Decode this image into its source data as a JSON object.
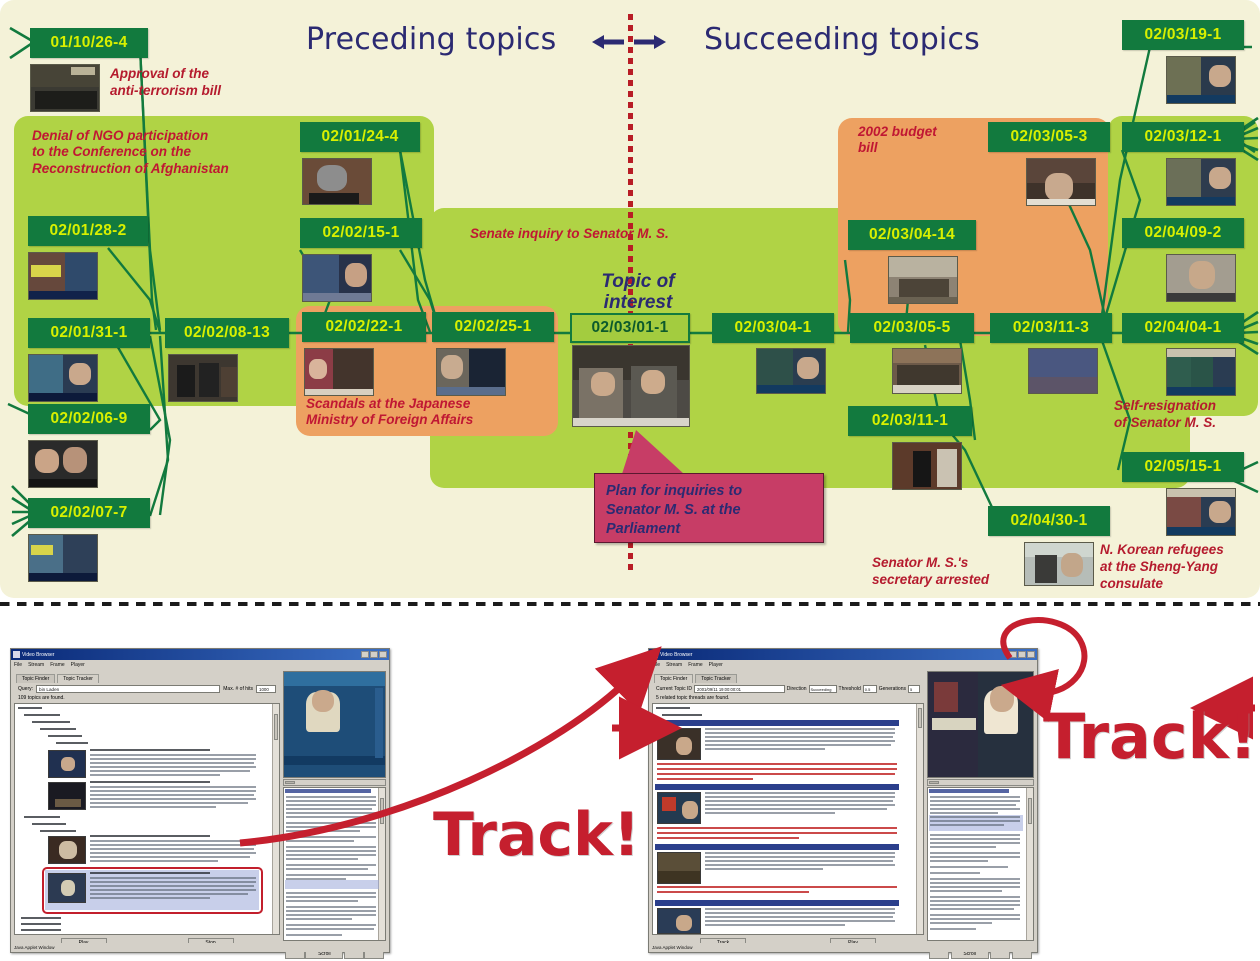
{
  "header": {
    "preceding": "Preceding topics",
    "succeeding": "Succeeding topics",
    "topic_of_interest": "Topic of\ninterest"
  },
  "colors": {
    "background": "#f4f2d8",
    "node_green": "#127a3e",
    "node_text": "#d8f000",
    "group_green": "#b0d345",
    "group_orange": "#eda161",
    "focus_node": "#a3cc3f",
    "caption_red": "#b51b2e",
    "header_blue": "#2b2a72",
    "axis_red": "#b81d25",
    "callout_pink": "#c73d66",
    "track_red": "#c51f2e"
  },
  "nodes": [
    {
      "id": "n01",
      "label": "01/10/26-4"
    },
    {
      "id": "n02",
      "label": "02/01/24-4"
    },
    {
      "id": "n03",
      "label": "02/01/28-2"
    },
    {
      "id": "n04",
      "label": "02/01/31-1"
    },
    {
      "id": "n05",
      "label": "02/02/06-9"
    },
    {
      "id": "n06",
      "label": "02/02/07-7"
    },
    {
      "id": "n07",
      "label": "02/02/08-13"
    },
    {
      "id": "n08",
      "label": "02/02/15-1"
    },
    {
      "id": "n09",
      "label": "02/02/22-1"
    },
    {
      "id": "n10",
      "label": "02/02/25-1"
    },
    {
      "id": "n11",
      "label": "02/03/01-1"
    },
    {
      "id": "n12",
      "label": "02/03/04-1"
    },
    {
      "id": "n13",
      "label": "02/03/04-14"
    },
    {
      "id": "n14",
      "label": "02/03/05-3"
    },
    {
      "id": "n15",
      "label": "02/03/05-5"
    },
    {
      "id": "n16",
      "label": "02/03/11-1"
    },
    {
      "id": "n17",
      "label": "02/03/11-3"
    },
    {
      "id": "n18",
      "label": "02/03/12-1"
    },
    {
      "id": "n19",
      "label": "02/03/19-1"
    },
    {
      "id": "n20",
      "label": "02/04/04-1"
    },
    {
      "id": "n21",
      "label": "02/04/09-2"
    },
    {
      "id": "n22",
      "label": "02/04/30-1"
    },
    {
      "id": "n23",
      "label": "02/05/15-1"
    }
  ],
  "group_labels": {
    "ngo": "Denial of NGO participation\nto the Conference on the\nReconstruction of Afghanistan",
    "senate": "Senate inquiry to Senator M. S.",
    "scandals": "Scandals at the Japanese\nMinistry of Foreign Affairs",
    "budget": "2002 budget\nbill"
  },
  "captions": {
    "approval": "Approval of the\nanti-terrorism bill",
    "self_resignation": "Self-resignation\nof Senator M. S.",
    "secretary": "Senator M. S.'s\nsecretary arrested",
    "refugees": "N. Korean refugees\nat the Sheng-Yang\nconsulate"
  },
  "callout": {
    "text": "Plan for inquiries to\nSenator M. S. at the\nParliament"
  },
  "track": {
    "left_label": "Track!",
    "right_label": "Track!"
  },
  "app_left": {
    "title": "Video Browser",
    "menu": [
      "File",
      "Stream",
      "Frame",
      "Player"
    ],
    "tabs": [
      "Topic Finder",
      "Topic Tracker"
    ],
    "active_tab": "Topic Finder",
    "query_label": "Query:",
    "query_value": "bin Laden",
    "max_label": "Max. # of hits",
    "max_value": "1000",
    "status": "109 topics are found.",
    "tree_root": "Tex Inc",
    "buttons": {
      "play": "Play",
      "stop": "Stop"
    },
    "text_buttons": {
      "prev": "Prev",
      "auto": "Automatic Scroll",
      "play": "Play",
      "next": "Next"
    },
    "statusbar": "Java Applet Window"
  },
  "app_right": {
    "title": "Video Browser",
    "menu": [
      "File",
      "Stream",
      "Frame",
      "Player"
    ],
    "tabs": [
      "Topic Finder",
      "Topic Tracker"
    ],
    "active_tab": "Topic Tracker",
    "current_topic_label": "Current Topic ID",
    "current_topic_value": "2001/09/11 19:00:00:01",
    "direction_label": "Direction",
    "direction_value": "Succeeding",
    "threshold_label": "Threshold",
    "threshold_value": "0.5",
    "generations_label": "Generations",
    "generations_value": "5",
    "status": "5 related topic threads are found.",
    "tree_root": "Related Topics",
    "tree_child": "Succeeding Topics",
    "buttons": {
      "track": "Track",
      "play": "Play"
    },
    "text_buttons": {
      "prev": "Prev",
      "auto": "Automatic Scroll",
      "play": "Play",
      "next": "Next"
    },
    "statusbar": "Java Applet Window"
  }
}
